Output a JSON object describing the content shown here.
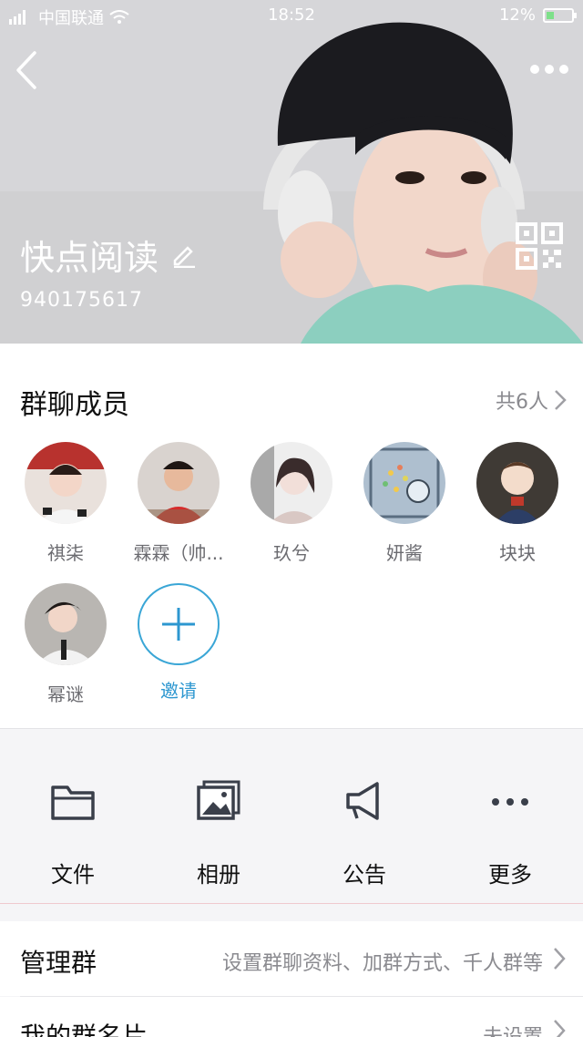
{
  "status_bar": {
    "carrier": "中国联通",
    "time": "18:52",
    "battery": "12%"
  },
  "header": {
    "group_name": "快点阅读",
    "group_id": "940175617",
    "icons": [
      "back-icon",
      "more-icon",
      "edit-icon",
      "qr-code-icon"
    ]
  },
  "members": {
    "title": "群聊成员",
    "count": "共6人",
    "list": [
      {
        "name": "祺柒"
      },
      {
        "name": "霖霖（帅..."
      },
      {
        "name": "玖兮"
      },
      {
        "name": "妍酱"
      },
      {
        "name": "块块"
      },
      {
        "name": "幂谜"
      }
    ],
    "invite_label": "邀请"
  },
  "actions": [
    {
      "label": "文件",
      "icon": "folder-icon"
    },
    {
      "label": "相册",
      "icon": "album-icon"
    },
    {
      "label": "公告",
      "icon": "megaphone-icon"
    },
    {
      "label": "更多",
      "icon": "more-dots-icon"
    }
  ],
  "rows": {
    "manage": {
      "title": "管理群",
      "value": "设置群聊资料、加群方式、千人群等"
    },
    "card": {
      "title": "我的群名片",
      "value": "未设置"
    }
  },
  "colors": {
    "accent": "#2d97d0",
    "text_primary": "#111111",
    "text_secondary": "#8a8a8f"
  }
}
